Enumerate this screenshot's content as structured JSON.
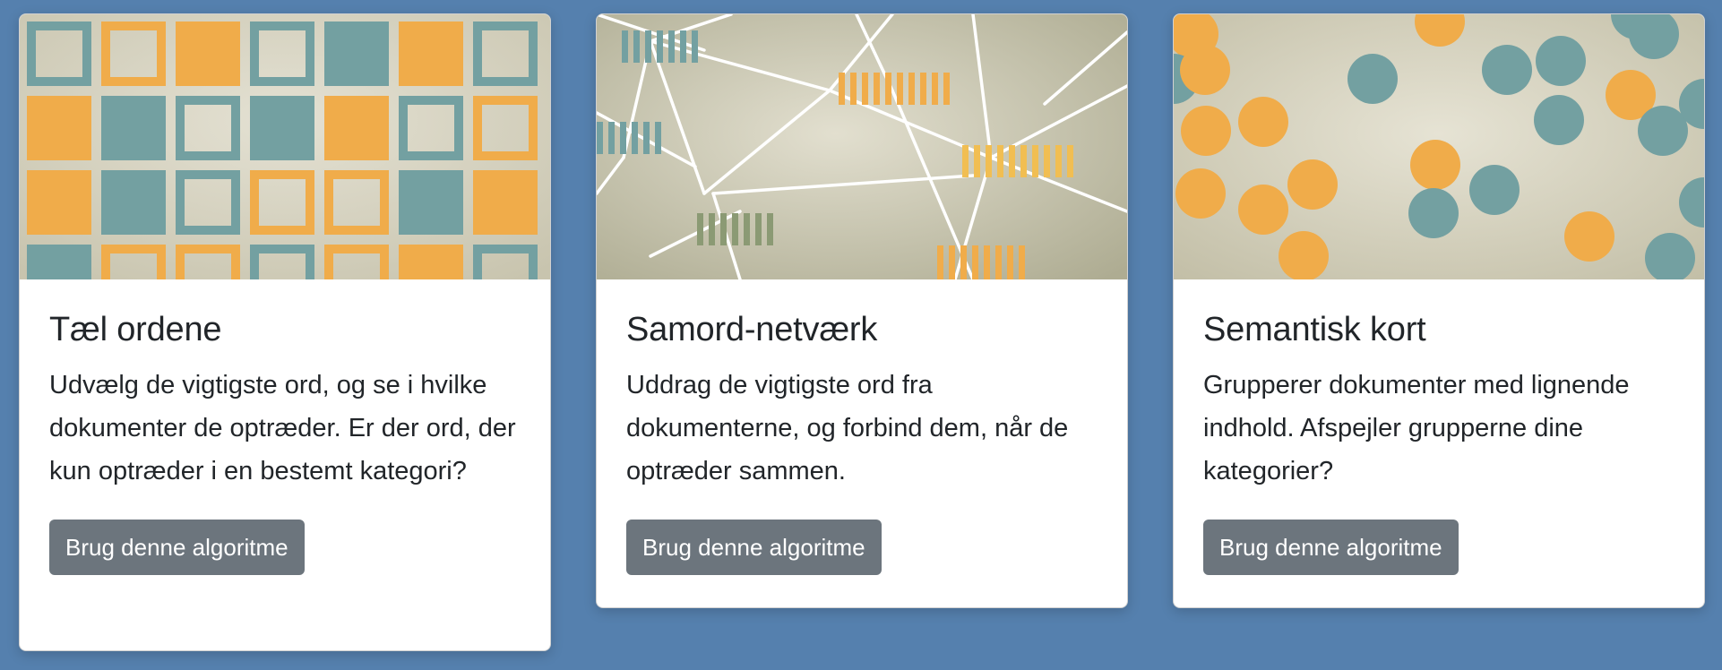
{
  "cards": [
    {
      "title": "Tæl ordene",
      "text": "Udvælg de vigtigste ord, og se i hvilke dokumenter de optræder. Er der ord, der kun optræder i en bestemt kategori?",
      "button_label": "Brug denne algoritme",
      "image": "grid-squares-illustration"
    },
    {
      "title": "Samord-netværk",
      "text": "Uddrag de vigtigste ord fra dokumenterne, og forbind dem, når de optræder sammen.",
      "button_label": "Brug denne algoritme",
      "image": "network-illustration"
    },
    {
      "title": "Semantisk kort",
      "text": "Grupperer dokumenter med lignende indhold. Afspejler grupperne dine kategorier?",
      "button_label": "Brug denne algoritme",
      "image": "circles-cluster-illustration"
    }
  ],
  "colors": {
    "page_background": "#5580ae",
    "button_background": "#6c757d",
    "illustration_orange": "#f0ac4a",
    "illustration_teal": "#73a0a1",
    "illustration_olive": "#8b9a74",
    "illustration_paper": "#d9d5c2"
  }
}
